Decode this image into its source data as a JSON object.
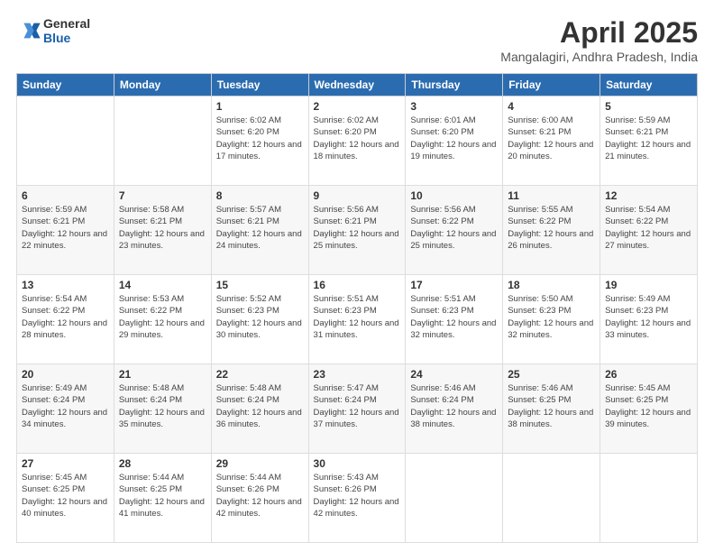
{
  "header": {
    "logo_line1": "General",
    "logo_line2": "Blue",
    "title": "April 2025",
    "subtitle": "Mangalagiri, Andhra Pradesh, India"
  },
  "days_of_week": [
    "Sunday",
    "Monday",
    "Tuesday",
    "Wednesday",
    "Thursday",
    "Friday",
    "Saturday"
  ],
  "weeks": [
    [
      {
        "day": "",
        "info": ""
      },
      {
        "day": "",
        "info": ""
      },
      {
        "day": "1",
        "info": "Sunrise: 6:02 AM\nSunset: 6:20 PM\nDaylight: 12 hours and 17 minutes."
      },
      {
        "day": "2",
        "info": "Sunrise: 6:02 AM\nSunset: 6:20 PM\nDaylight: 12 hours and 18 minutes."
      },
      {
        "day": "3",
        "info": "Sunrise: 6:01 AM\nSunset: 6:20 PM\nDaylight: 12 hours and 19 minutes."
      },
      {
        "day": "4",
        "info": "Sunrise: 6:00 AM\nSunset: 6:21 PM\nDaylight: 12 hours and 20 minutes."
      },
      {
        "day": "5",
        "info": "Sunrise: 5:59 AM\nSunset: 6:21 PM\nDaylight: 12 hours and 21 minutes."
      }
    ],
    [
      {
        "day": "6",
        "info": "Sunrise: 5:59 AM\nSunset: 6:21 PM\nDaylight: 12 hours and 22 minutes."
      },
      {
        "day": "7",
        "info": "Sunrise: 5:58 AM\nSunset: 6:21 PM\nDaylight: 12 hours and 23 minutes."
      },
      {
        "day": "8",
        "info": "Sunrise: 5:57 AM\nSunset: 6:21 PM\nDaylight: 12 hours and 24 minutes."
      },
      {
        "day": "9",
        "info": "Sunrise: 5:56 AM\nSunset: 6:21 PM\nDaylight: 12 hours and 25 minutes."
      },
      {
        "day": "10",
        "info": "Sunrise: 5:56 AM\nSunset: 6:22 PM\nDaylight: 12 hours and 25 minutes."
      },
      {
        "day": "11",
        "info": "Sunrise: 5:55 AM\nSunset: 6:22 PM\nDaylight: 12 hours and 26 minutes."
      },
      {
        "day": "12",
        "info": "Sunrise: 5:54 AM\nSunset: 6:22 PM\nDaylight: 12 hours and 27 minutes."
      }
    ],
    [
      {
        "day": "13",
        "info": "Sunrise: 5:54 AM\nSunset: 6:22 PM\nDaylight: 12 hours and 28 minutes."
      },
      {
        "day": "14",
        "info": "Sunrise: 5:53 AM\nSunset: 6:22 PM\nDaylight: 12 hours and 29 minutes."
      },
      {
        "day": "15",
        "info": "Sunrise: 5:52 AM\nSunset: 6:23 PM\nDaylight: 12 hours and 30 minutes."
      },
      {
        "day": "16",
        "info": "Sunrise: 5:51 AM\nSunset: 6:23 PM\nDaylight: 12 hours and 31 minutes."
      },
      {
        "day": "17",
        "info": "Sunrise: 5:51 AM\nSunset: 6:23 PM\nDaylight: 12 hours and 32 minutes."
      },
      {
        "day": "18",
        "info": "Sunrise: 5:50 AM\nSunset: 6:23 PM\nDaylight: 12 hours and 32 minutes."
      },
      {
        "day": "19",
        "info": "Sunrise: 5:49 AM\nSunset: 6:23 PM\nDaylight: 12 hours and 33 minutes."
      }
    ],
    [
      {
        "day": "20",
        "info": "Sunrise: 5:49 AM\nSunset: 6:24 PM\nDaylight: 12 hours and 34 minutes."
      },
      {
        "day": "21",
        "info": "Sunrise: 5:48 AM\nSunset: 6:24 PM\nDaylight: 12 hours and 35 minutes."
      },
      {
        "day": "22",
        "info": "Sunrise: 5:48 AM\nSunset: 6:24 PM\nDaylight: 12 hours and 36 minutes."
      },
      {
        "day": "23",
        "info": "Sunrise: 5:47 AM\nSunset: 6:24 PM\nDaylight: 12 hours and 37 minutes."
      },
      {
        "day": "24",
        "info": "Sunrise: 5:46 AM\nSunset: 6:24 PM\nDaylight: 12 hours and 38 minutes."
      },
      {
        "day": "25",
        "info": "Sunrise: 5:46 AM\nSunset: 6:25 PM\nDaylight: 12 hours and 38 minutes."
      },
      {
        "day": "26",
        "info": "Sunrise: 5:45 AM\nSunset: 6:25 PM\nDaylight: 12 hours and 39 minutes."
      }
    ],
    [
      {
        "day": "27",
        "info": "Sunrise: 5:45 AM\nSunset: 6:25 PM\nDaylight: 12 hours and 40 minutes."
      },
      {
        "day": "28",
        "info": "Sunrise: 5:44 AM\nSunset: 6:25 PM\nDaylight: 12 hours and 41 minutes."
      },
      {
        "day": "29",
        "info": "Sunrise: 5:44 AM\nSunset: 6:26 PM\nDaylight: 12 hours and 42 minutes."
      },
      {
        "day": "30",
        "info": "Sunrise: 5:43 AM\nSunset: 6:26 PM\nDaylight: 12 hours and 42 minutes."
      },
      {
        "day": "",
        "info": ""
      },
      {
        "day": "",
        "info": ""
      },
      {
        "day": "",
        "info": ""
      }
    ]
  ]
}
